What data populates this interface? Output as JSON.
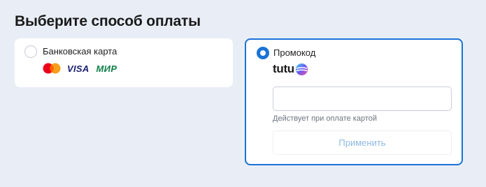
{
  "page": {
    "title": "Выберите способ оплаты"
  },
  "options": {
    "bank_card": {
      "label": "Банковская карта",
      "selected": false,
      "logos": {
        "mastercard": "mastercard-logo",
        "visa": "VISA",
        "mir": "МИР"
      }
    },
    "promo_code": {
      "label": "Промокод",
      "selected": true,
      "brand": "tutu",
      "input_value": "",
      "hint": "Действует при оплате картой",
      "apply_label": "Применить",
      "apply_enabled": false
    }
  },
  "colors": {
    "accent": "#1a73d6",
    "background": "#e9eef6",
    "disabled_text": "#8fb8e6",
    "mir_green": "#0f7f4a",
    "visa_blue": "#1a1f71"
  }
}
